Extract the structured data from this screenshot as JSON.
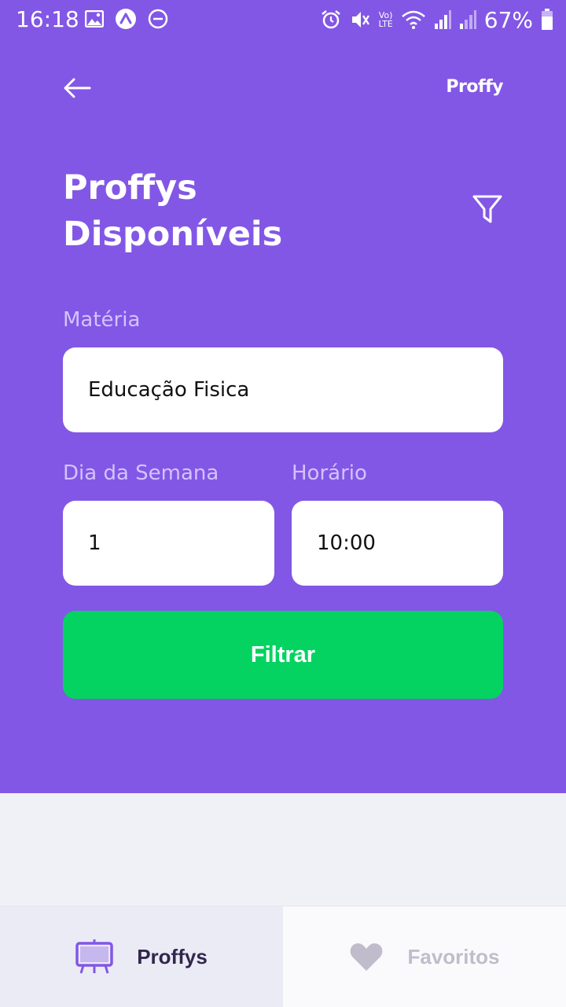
{
  "status_bar": {
    "time": "16:18",
    "battery": "67%",
    "network": "Vo) LTE"
  },
  "header": {
    "logo": "Proffy",
    "title_line1": "Proffys",
    "title_line2": "Disponíveis"
  },
  "form": {
    "subject_label": "Matéria",
    "subject_value": "Educação Fisica",
    "weekday_label": "Dia da Semana",
    "weekday_value": "1",
    "time_label": "Horário",
    "time_value": "10:00",
    "submit_label": "Filtrar"
  },
  "tabs": [
    {
      "label": "Proffys",
      "icon": "easel-icon",
      "active": true
    },
    {
      "label": "Favoritos",
      "icon": "heart-icon",
      "active": false
    }
  ],
  "colors": {
    "primary": "#8257E5",
    "secondary": "#04D361",
    "background": "#F0F0F7",
    "label": "#D4C2FF",
    "tab_active_text": "#32264D",
    "tab_inactive_text": "#C1BCCC"
  }
}
